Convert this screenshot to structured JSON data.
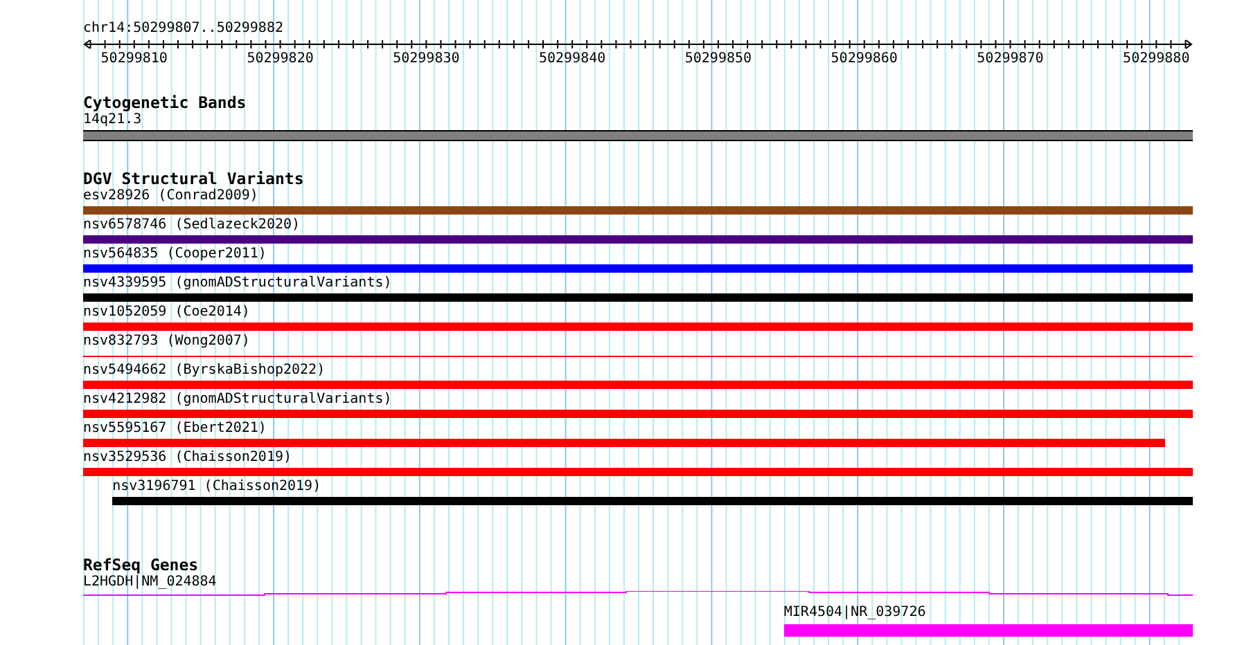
{
  "ruler": {
    "position": "chr14:50299807..50299882",
    "labels": [
      "50299810",
      "50299820",
      "50299830",
      "50299840",
      "50299850",
      "50299860",
      "50299870",
      "50299880"
    ]
  },
  "tracks": [
    {
      "title": "Cytogenetic Bands",
      "features": [
        {
          "name": "14q21.3",
          "kind": "band",
          "color": "#808080"
        }
      ]
    },
    {
      "title": "DGV Structural Variants",
      "features": [
        {
          "name": "esv28926 (Conrad2009)",
          "kind": "block",
          "color": "#8b4513"
        },
        {
          "name": "nsv6578746 (Sedlazeck2020)",
          "kind": "block",
          "color": "#4b0082"
        },
        {
          "name": "nsv564835 (Cooper2011)",
          "kind": "block",
          "color": "#0000ff"
        },
        {
          "name": "nsv4339595 (gnomADStructuralVariants)",
          "kind": "block",
          "color": "#000000"
        },
        {
          "name": "nsv1052059 (Coe2014)",
          "kind": "block",
          "color": "#ff0000"
        },
        {
          "name": "nsv832793 (Wong2007)",
          "kind": "line",
          "color": "#ff0000"
        },
        {
          "name": "nsv5494662 (ByrskaBishop2022)",
          "kind": "block",
          "color": "#ff0000"
        },
        {
          "name": "nsv4212982 (gnomADStructuralVariants)",
          "kind": "block",
          "color": "#ff0000"
        },
        {
          "name": "nsv5595167 (Ebert2021)",
          "kind": "short",
          "color": "#ff0000"
        },
        {
          "name": "nsv3529536 (Chaisson2019)",
          "kind": "block",
          "color": "#ff0000"
        },
        {
          "name": "nsv3196791 (Chaisson2019)",
          "kind": "tail",
          "color": "#000000"
        }
      ]
    },
    {
      "title": "RefSeq Genes",
      "features": [
        {
          "name": "L2HGDH|NM_024884",
          "kind": "intron",
          "color": "#ff00ff"
        },
        {
          "name": "MIR4504|NR_039726",
          "kind": "exon",
          "color": "#ff00ff"
        }
      ]
    }
  ]
}
